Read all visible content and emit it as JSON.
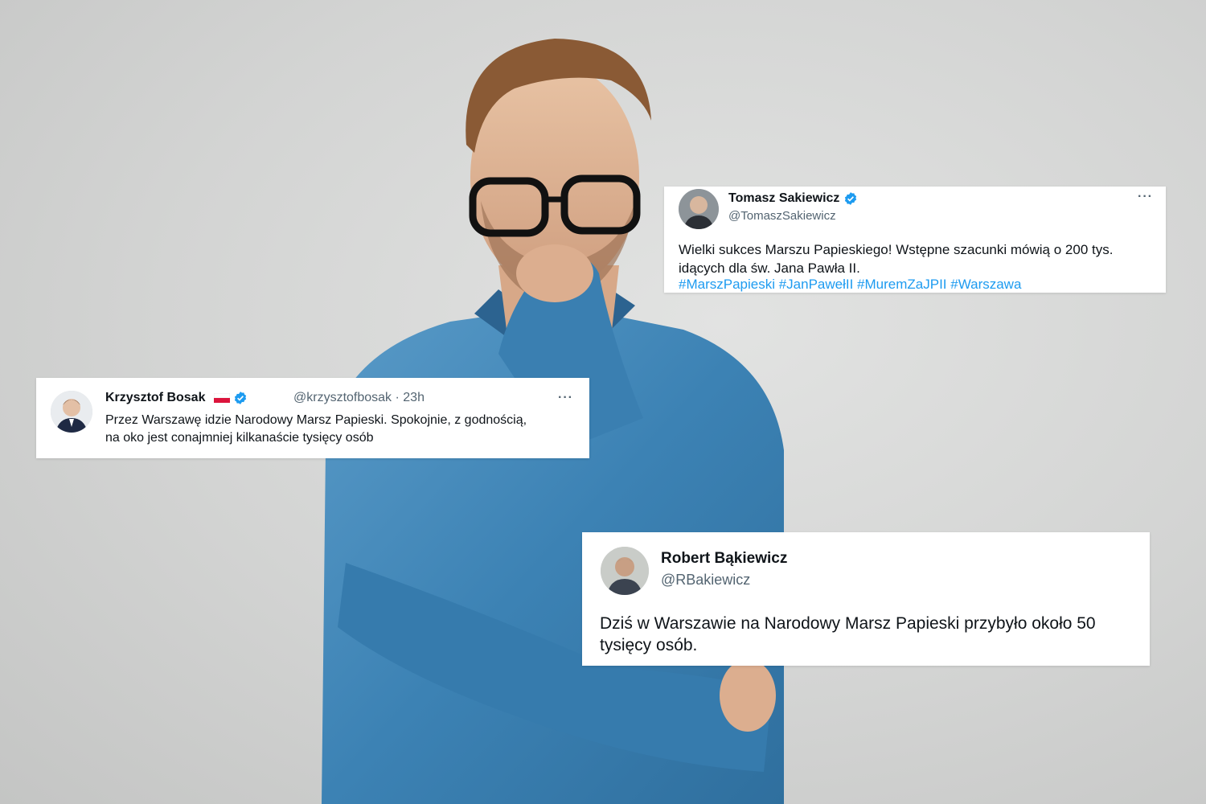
{
  "tweets": {
    "sakiewicz": {
      "name": "Tomasz Sakiewicz",
      "handle": "@TomaszSakiewicz",
      "text_line1": "Wielki sukces Marszu Papieskiego! Wstępne szacunki mówią o 200 tys.",
      "text_line2": "idących dla św. Jana Pawła II.",
      "hashtags": "#MarszPapieski #JanPawełII #MuremZaJPII #Warszawa",
      "more": "···"
    },
    "bosak": {
      "name": "Krzysztof Bosak",
      "handle": "@krzysztofbosak · 23h",
      "text_line1": "Przez Warszawę idzie Narodowy Marsz Papieski. Spokojnie, z godnością,",
      "text_line2": "na oko jest conajmniej kilkanaście tysięcy osób",
      "more": "···"
    },
    "bakiewicz": {
      "name": "Robert Bąkiewicz",
      "handle": "@RBakiewicz",
      "text_line1": "Dziś w Warszawie na Narodowy Marsz Papieski przybyło około 50",
      "text_line2": "tysięcy osób."
    }
  },
  "colors": {
    "link": "#1d9bf0",
    "verified": "#1d9bf0",
    "shirt": "#3f87b8"
  },
  "icons": [
    "verified-badge-icon",
    "more-options-icon",
    "poland-flag-icon"
  ]
}
